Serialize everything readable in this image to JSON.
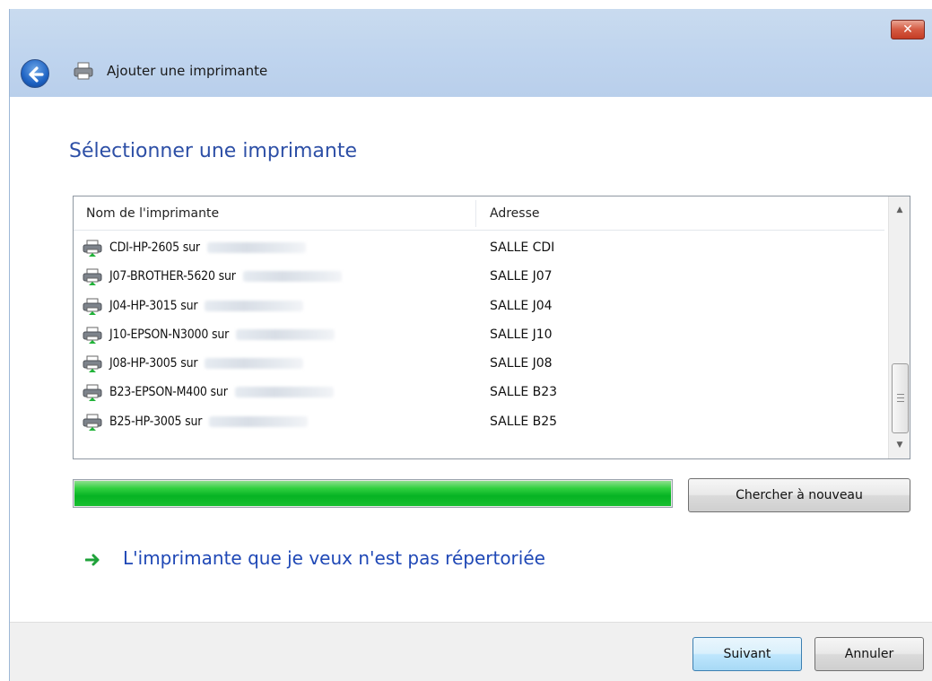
{
  "window": {
    "title": "Ajouter une imprimante",
    "close_label": "✕"
  },
  "page": {
    "title": "Sélectionner une imprimante"
  },
  "list": {
    "columns": [
      "Nom de l'imprimante",
      "Adresse"
    ],
    "rows": [
      {
        "name": "CDI-HP-2605 sur",
        "address": "SALLE CDI"
      },
      {
        "name": "J07-BROTHER-5620 sur",
        "address": "SALLE J07"
      },
      {
        "name": "J04-HP-3015 sur",
        "address": "SALLE J04"
      },
      {
        "name": "J10-EPSON-N3000 sur",
        "address": "SALLE J10"
      },
      {
        "name": "J08-HP-3005 sur",
        "address": "SALLE J08"
      },
      {
        "name": "B23-EPSON-M400 sur",
        "address": "SALLE B23"
      },
      {
        "name": "B25-HP-3005 sur",
        "address": "SALLE B25"
      }
    ],
    "scrollbar_position": 0.75
  },
  "progress": {
    "value": 1.0,
    "color": "#06b323"
  },
  "buttons": {
    "search_again": "Chercher à nouveau",
    "next": "Suivant",
    "cancel": "Annuler"
  },
  "link": {
    "text": "L'imprimante que je veux n'est pas répertoriée",
    "icon": "green-arrow-icon"
  },
  "colors": {
    "title_blue": "#2d4fa6",
    "link_blue": "#1f48b6",
    "progress_green": "#06b323"
  }
}
